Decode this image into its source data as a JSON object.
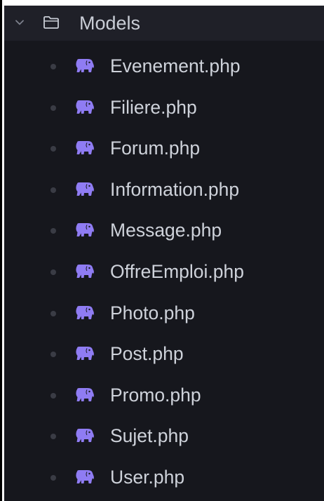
{
  "explorer": {
    "folder": {
      "name": "Models",
      "expanded": true,
      "icon": "folder-open-icon",
      "chevron": "chevron-down-icon"
    },
    "files": [
      {
        "name": "Evenement.php",
        "icon": "php-elephant-icon"
      },
      {
        "name": "Filiere.php",
        "icon": "php-elephant-icon"
      },
      {
        "name": "Forum.php",
        "icon": "php-elephant-icon"
      },
      {
        "name": "Information.php",
        "icon": "php-elephant-icon"
      },
      {
        "name": "Message.php",
        "icon": "php-elephant-icon"
      },
      {
        "name": "OffreEmploi.php",
        "icon": "php-elephant-icon"
      },
      {
        "name": "Photo.php",
        "icon": "php-elephant-icon"
      },
      {
        "name": "Post.php",
        "icon": "php-elephant-icon"
      },
      {
        "name": "Promo.php",
        "icon": "php-elephant-icon"
      },
      {
        "name": "Sujet.php",
        "icon": "php-elephant-icon"
      },
      {
        "name": "User.php",
        "icon": "php-elephant-icon"
      }
    ]
  },
  "colors": {
    "panel_background": "#16171d",
    "folder_row_background": "#1f2028",
    "text": "#ced2da",
    "php_icon": "#8f7cf3",
    "indent_dot": "#3a3c45"
  }
}
